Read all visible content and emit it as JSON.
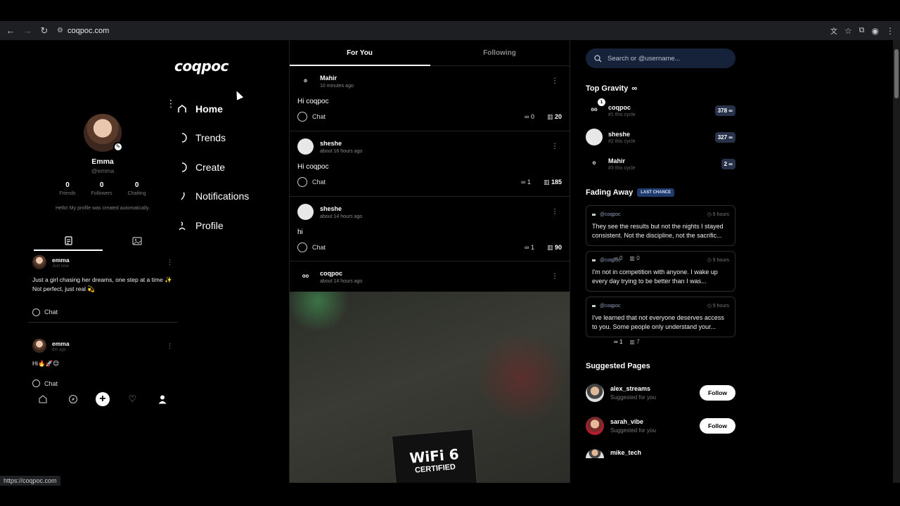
{
  "browser": {
    "url": "coqpoc.com",
    "status_url": "https://coqpoc.com"
  },
  "app": {
    "logo": "coqpoc",
    "nav": [
      {
        "label": "Home"
      },
      {
        "label": "Trends"
      },
      {
        "label": "Create"
      },
      {
        "label": "Notifications"
      },
      {
        "label": "Profile"
      }
    ],
    "profile": {
      "name": "Emma",
      "handle": "@emma",
      "stats": [
        {
          "num": "0",
          "label": "Friends"
        },
        {
          "num": "0",
          "label": "Followers"
        },
        {
          "num": "0",
          "label": "Chatting"
        }
      ],
      "bio": "Hello! My profile was created automatically."
    },
    "my_posts": [
      {
        "user": "emma",
        "time": "Just now",
        "text1": "Just a girl chasing her dreams, one step at a time ✨",
        "text2": "Not perfect, just real 💫",
        "chat": "Chat",
        "grav": "0",
        "views": "0"
      },
      {
        "user": "emma",
        "time": "8m ago",
        "text1": "Hi🔥🚀😊",
        "text2": "",
        "chat": "Chat",
        "grav": "1",
        "views": "7"
      }
    ]
  },
  "feed": {
    "tabs": [
      "For You",
      "Following"
    ],
    "posts": [
      {
        "user": "Mahir",
        "time": "10 minutes ago",
        "text": "Hi coqpoc",
        "chat": "Chat",
        "grav": "0",
        "views": "20"
      },
      {
        "user": "sheshe",
        "time": "about 16 hours ago",
        "text": "Hi coqpoc",
        "chat": "Chat",
        "grav": "1",
        "views": "185"
      },
      {
        "user": "sheshe",
        "time": "about 14 hours ago",
        "text": "hi",
        "chat": "Chat",
        "grav": "1",
        "views": "90"
      },
      {
        "user": "coqpoc",
        "time": "about 14 hours ago",
        "image_title": "WiFi 6",
        "image_sub": "CERTIFIED"
      }
    ]
  },
  "sidebar": {
    "search_placeholder": "Search or @username...",
    "top_gravity": {
      "title": "Top Gravity",
      "items": [
        {
          "name": "coqpoc",
          "rank": "#1 this cycle",
          "score": "378",
          "badge": "1"
        },
        {
          "name": "sheshe",
          "rank": "#2 this cycle",
          "score": "327"
        },
        {
          "name": "Mahir",
          "rank": "#3 this cycle",
          "score": "2"
        }
      ]
    },
    "fading_away": {
      "title": "Fading Away",
      "badge": "LAST CHANCE",
      "items": [
        {
          "user": "@coqpoc",
          "time": "9 hours",
          "text": "They see the results but not the nights I stayed consistent. Not the discipline, not the sacrific..."
        },
        {
          "user": "@coqpoc",
          "time": "9 hours",
          "text": "I'm not in competition with anyone. I wake up every day trying to be better than I was..."
        },
        {
          "user": "@coqpoc",
          "time": "9 hours",
          "text": "I've learned that not everyone deserves access to you. Some people only understand your..."
        }
      ]
    },
    "suggested": {
      "title": "Suggested Pages",
      "items": [
        {
          "name": "alex_streams",
          "sub": "Suggested for you",
          "button": "Follow"
        },
        {
          "name": "sarah_vibe",
          "sub": "Suggested for you",
          "button": "Follow"
        },
        {
          "name": "mike_tech"
        }
      ]
    }
  },
  "icons": {
    "infinity": "∞"
  }
}
